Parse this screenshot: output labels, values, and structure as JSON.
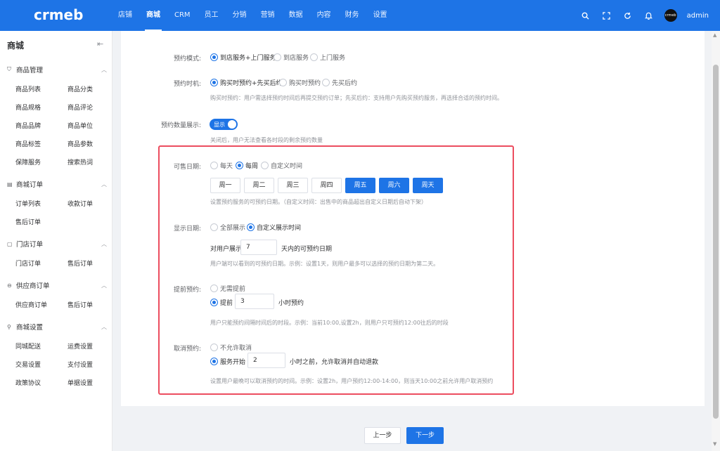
{
  "header": {
    "logo": "crmeb",
    "nav": [
      "店铺",
      "商城",
      "CRM",
      "员工",
      "分销",
      "营销",
      "数据",
      "内容",
      "财务",
      "设置"
    ],
    "active_nav": "商城",
    "user": "admin",
    "avatar_text": "crmeb",
    "icons": [
      "search-icon",
      "fullscreen-icon",
      "refresh-icon",
      "bell-icon"
    ]
  },
  "sidebar": {
    "title": "商城",
    "collapse_icon": "⇤",
    "groups": [
      {
        "title": "商品管理",
        "icon": "cart-icon",
        "items": [
          "商品列表",
          "商品分类",
          "商品规格",
          "商品评论",
          "商品品牌",
          "商品单位",
          "商品标签",
          "商品参数",
          "保障服务",
          "搜索热词"
        ]
      },
      {
        "title": "商城订单",
        "icon": "order-icon",
        "items": [
          "订单列表",
          "收款订单",
          "售后订单"
        ]
      },
      {
        "title": "门店订单",
        "icon": "store-icon",
        "items": [
          "门店订单",
          "售后订单"
        ]
      },
      {
        "title": "供应商订单",
        "icon": "supplier-icon",
        "items": [
          "供应商订单",
          "售后订单"
        ]
      },
      {
        "title": "商城设置",
        "icon": "wrench-icon",
        "items": [
          "同城配送",
          "运费设置",
          "交易设置",
          "支付设置",
          "政策协议",
          "单据设置"
        ]
      }
    ]
  },
  "form": {
    "mode": {
      "label": "预约模式:",
      "options": [
        "到店服务+上门服务",
        "到店服务",
        "上门服务"
      ],
      "selected": "到店服务+上门服务"
    },
    "timing": {
      "label": "预约时机:",
      "options": [
        "购买时预约+先买后约",
        "购买时预约",
        "先买后约"
      ],
      "selected": "购买时预约+先买后约",
      "hint": "购买时预约：用户需选择预约时间后再提交预约订单；先买后约：支持用户先购买预约服务，再选择合适的预约时间。"
    },
    "quantity_display": {
      "label": "预约数量展示:",
      "switch_text": "显示",
      "on": true,
      "hint": "关闭后，用户无法查看各时段的剩余预约数量"
    },
    "sale_date": {
      "label": "可售日期:",
      "options": [
        "每天",
        "每周",
        "自定义时间"
      ],
      "selected": "每周",
      "days": [
        "周一",
        "周二",
        "周三",
        "周四",
        "周五",
        "周六",
        "周天"
      ],
      "days_selected": [
        "周五",
        "周六",
        "周天"
      ],
      "hint": "设置预约服务的可预约日期。（自定义时间：出售中的商品超出自定义日期后自动下架）"
    },
    "display_date": {
      "label": "显示日期:",
      "options": [
        "全部展示",
        "自定义展示时间"
      ],
      "selected": "自定义展示时间",
      "prefix": "对用户展示",
      "value": "7",
      "suffix": "天内的可预约日期",
      "hint": "用户端可以看到的可预约日期。示例：设置1天，则用户最多可以选择的预约日期为第二天。"
    },
    "advance": {
      "label": "提前预约:",
      "options": [
        "无需提前",
        "提前"
      ],
      "selected": "提前",
      "value": "3",
      "suffix": "小时预约",
      "hint": "用户只能预约间隔时间后的时段。示例：当前10:00,设置2h，则用户只可预约12:00往后的时段"
    },
    "cancel": {
      "label": "取消预约:",
      "options": [
        "不允许取消",
        "服务开始"
      ],
      "selected": "服务开始",
      "value": "2",
      "suffix": "小时之前，允许取消并自动退款",
      "hint": "设置用户最晚可以取消预约的时间。示例：设置2h，用户预约12:00-14:00，则当天10:00之前允许用户取消预约"
    }
  },
  "footer": {
    "prev": "上一步",
    "next": "下一步"
  },
  "colors": {
    "primary": "#1e74e6",
    "highlight_border": "#ec4d5f"
  }
}
